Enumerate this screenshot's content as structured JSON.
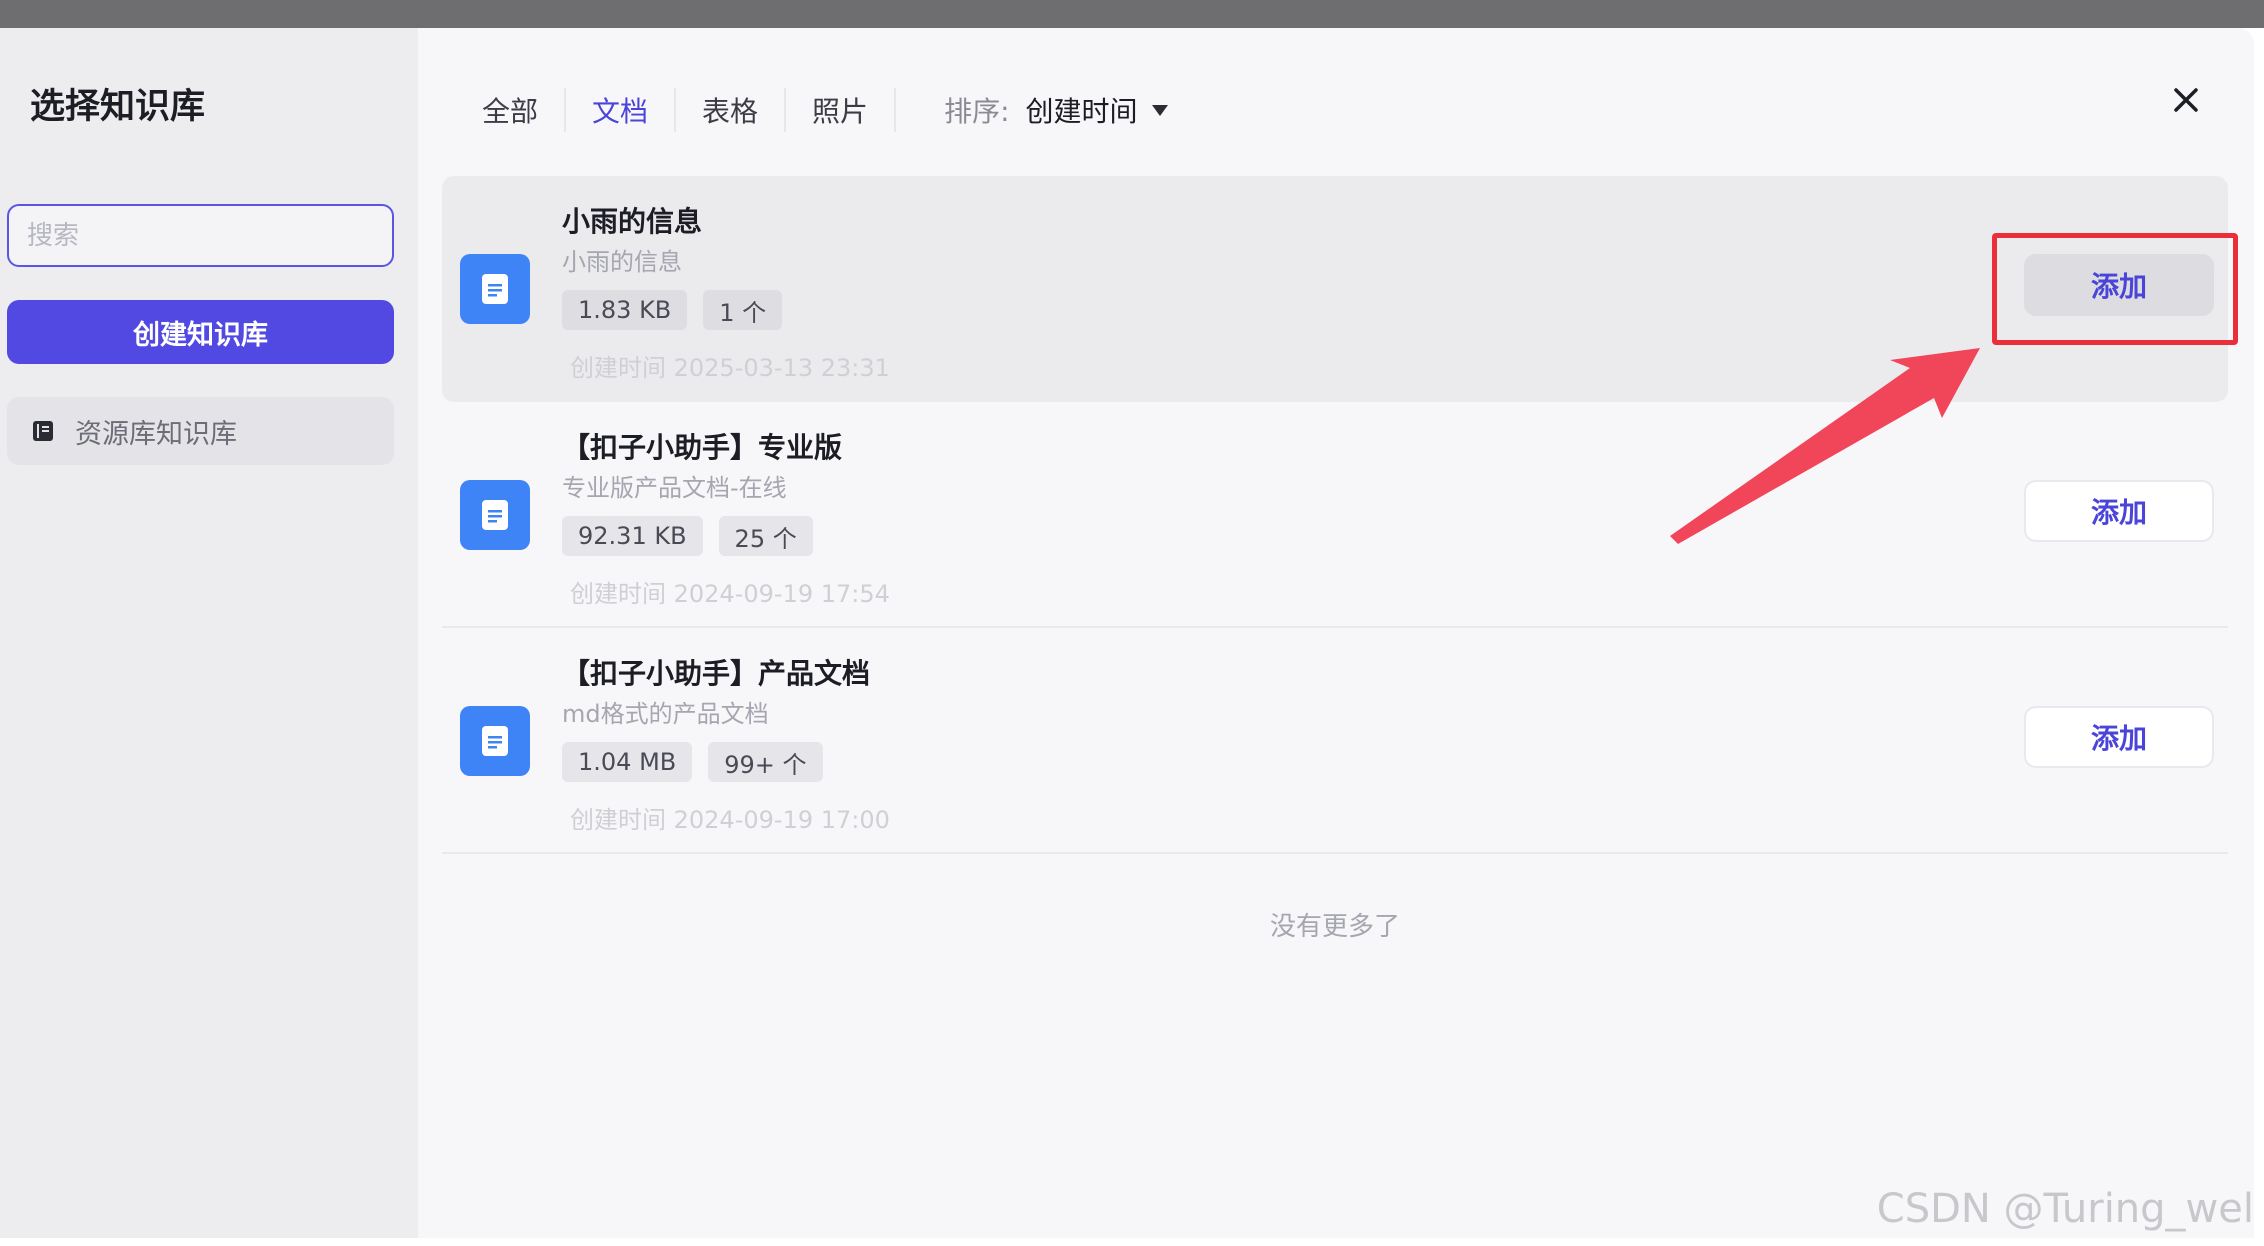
{
  "sidebar": {
    "title": "选择知识库",
    "search_placeholder": "搜索",
    "create_label": "创建知识库",
    "kb_items": [
      {
        "label": "资源库知识库",
        "icon": "book-icon"
      }
    ]
  },
  "tabs": [
    {
      "label": "全部",
      "active": false
    },
    {
      "label": "文档",
      "active": true
    },
    {
      "label": "表格",
      "active": false
    },
    {
      "label": "照片",
      "active": false
    }
  ],
  "sort": {
    "label": "排序:",
    "value": "创建时间"
  },
  "rows": [
    {
      "title": "小雨的信息",
      "desc": "小雨的信息",
      "size": "1.83 KB",
      "count": "1 个",
      "date": "创建时间 2025-03-13 23:31",
      "add_label": "添加"
    },
    {
      "title": "【扣子小助手】专业版",
      "desc": "专业版产品文档-在线",
      "size": "92.31 KB",
      "count": "25 个",
      "date": "创建时间 2024-09-19 17:54",
      "add_label": "添加"
    },
    {
      "title": "【扣子小助手】产品文档",
      "desc": "md格式的产品文档",
      "size": "1.04 MB",
      "count": "99+ 个",
      "date": "创建时间 2024-09-19 17:00",
      "add_label": "添加"
    }
  ],
  "footer": {
    "no_more": "没有更多了"
  },
  "watermark": "CSDN @Turing_wel",
  "colors": {
    "accent": "#5248e2",
    "doc_icon": "#3f84f6",
    "annotation": "#ea2f3a"
  }
}
